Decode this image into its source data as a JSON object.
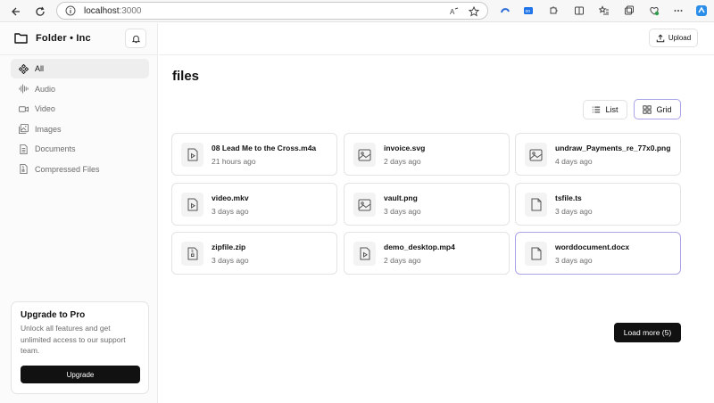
{
  "browser": {
    "url_host": "localhost",
    "url_port": ":3000"
  },
  "brand": {
    "name": "Folder • Inc"
  },
  "sidebar": {
    "items": [
      {
        "label": "All",
        "icon": "grid-diamond-icon",
        "active": true
      },
      {
        "label": "Audio",
        "icon": "audio-wave-icon",
        "active": false
      },
      {
        "label": "Video",
        "icon": "video-camera-icon",
        "active": false
      },
      {
        "label": "Images",
        "icon": "images-icon",
        "active": false
      },
      {
        "label": "Documents",
        "icon": "document-icon",
        "active": false
      },
      {
        "label": "Compressed Files",
        "icon": "archive-icon",
        "active": false
      }
    ]
  },
  "promo": {
    "title": "Upgrade to Pro",
    "text": "Unlock all features and get unlimited access to our support team.",
    "button": "Upgrade"
  },
  "topbar": {
    "upload_label": "Upload"
  },
  "main": {
    "heading": "files",
    "view_list_label": "List",
    "view_grid_label": "Grid",
    "load_more_label": "Load more (5)",
    "files": [
      {
        "name": "08 Lead Me to the Cross.m4a",
        "date": "21 hours ago",
        "icon": "media-file-icon"
      },
      {
        "name": "invoice.svg",
        "date": "2 days ago",
        "icon": "image-file-icon"
      },
      {
        "name": "undraw_Payments_re_77x0.png",
        "date": "4 days ago",
        "icon": "image-file-icon"
      },
      {
        "name": "video.mkv",
        "date": "3 days ago",
        "icon": "media-file-icon"
      },
      {
        "name": "vault.png",
        "date": "3 days ago",
        "icon": "image-file-icon"
      },
      {
        "name": "tsfile.ts",
        "date": "3 days ago",
        "icon": "file-icon"
      },
      {
        "name": "zipfile.zip",
        "date": "3 days ago",
        "icon": "zip-file-icon"
      },
      {
        "name": "demo_desktop.mp4",
        "date": "2 days ago",
        "icon": "media-file-icon"
      },
      {
        "name": "worddocument.docx",
        "date": "3 days ago",
        "icon": "file-icon",
        "selected": true
      }
    ]
  },
  "colors": {
    "accent_border": "#a9a4e8",
    "button_dark": "#111111"
  }
}
